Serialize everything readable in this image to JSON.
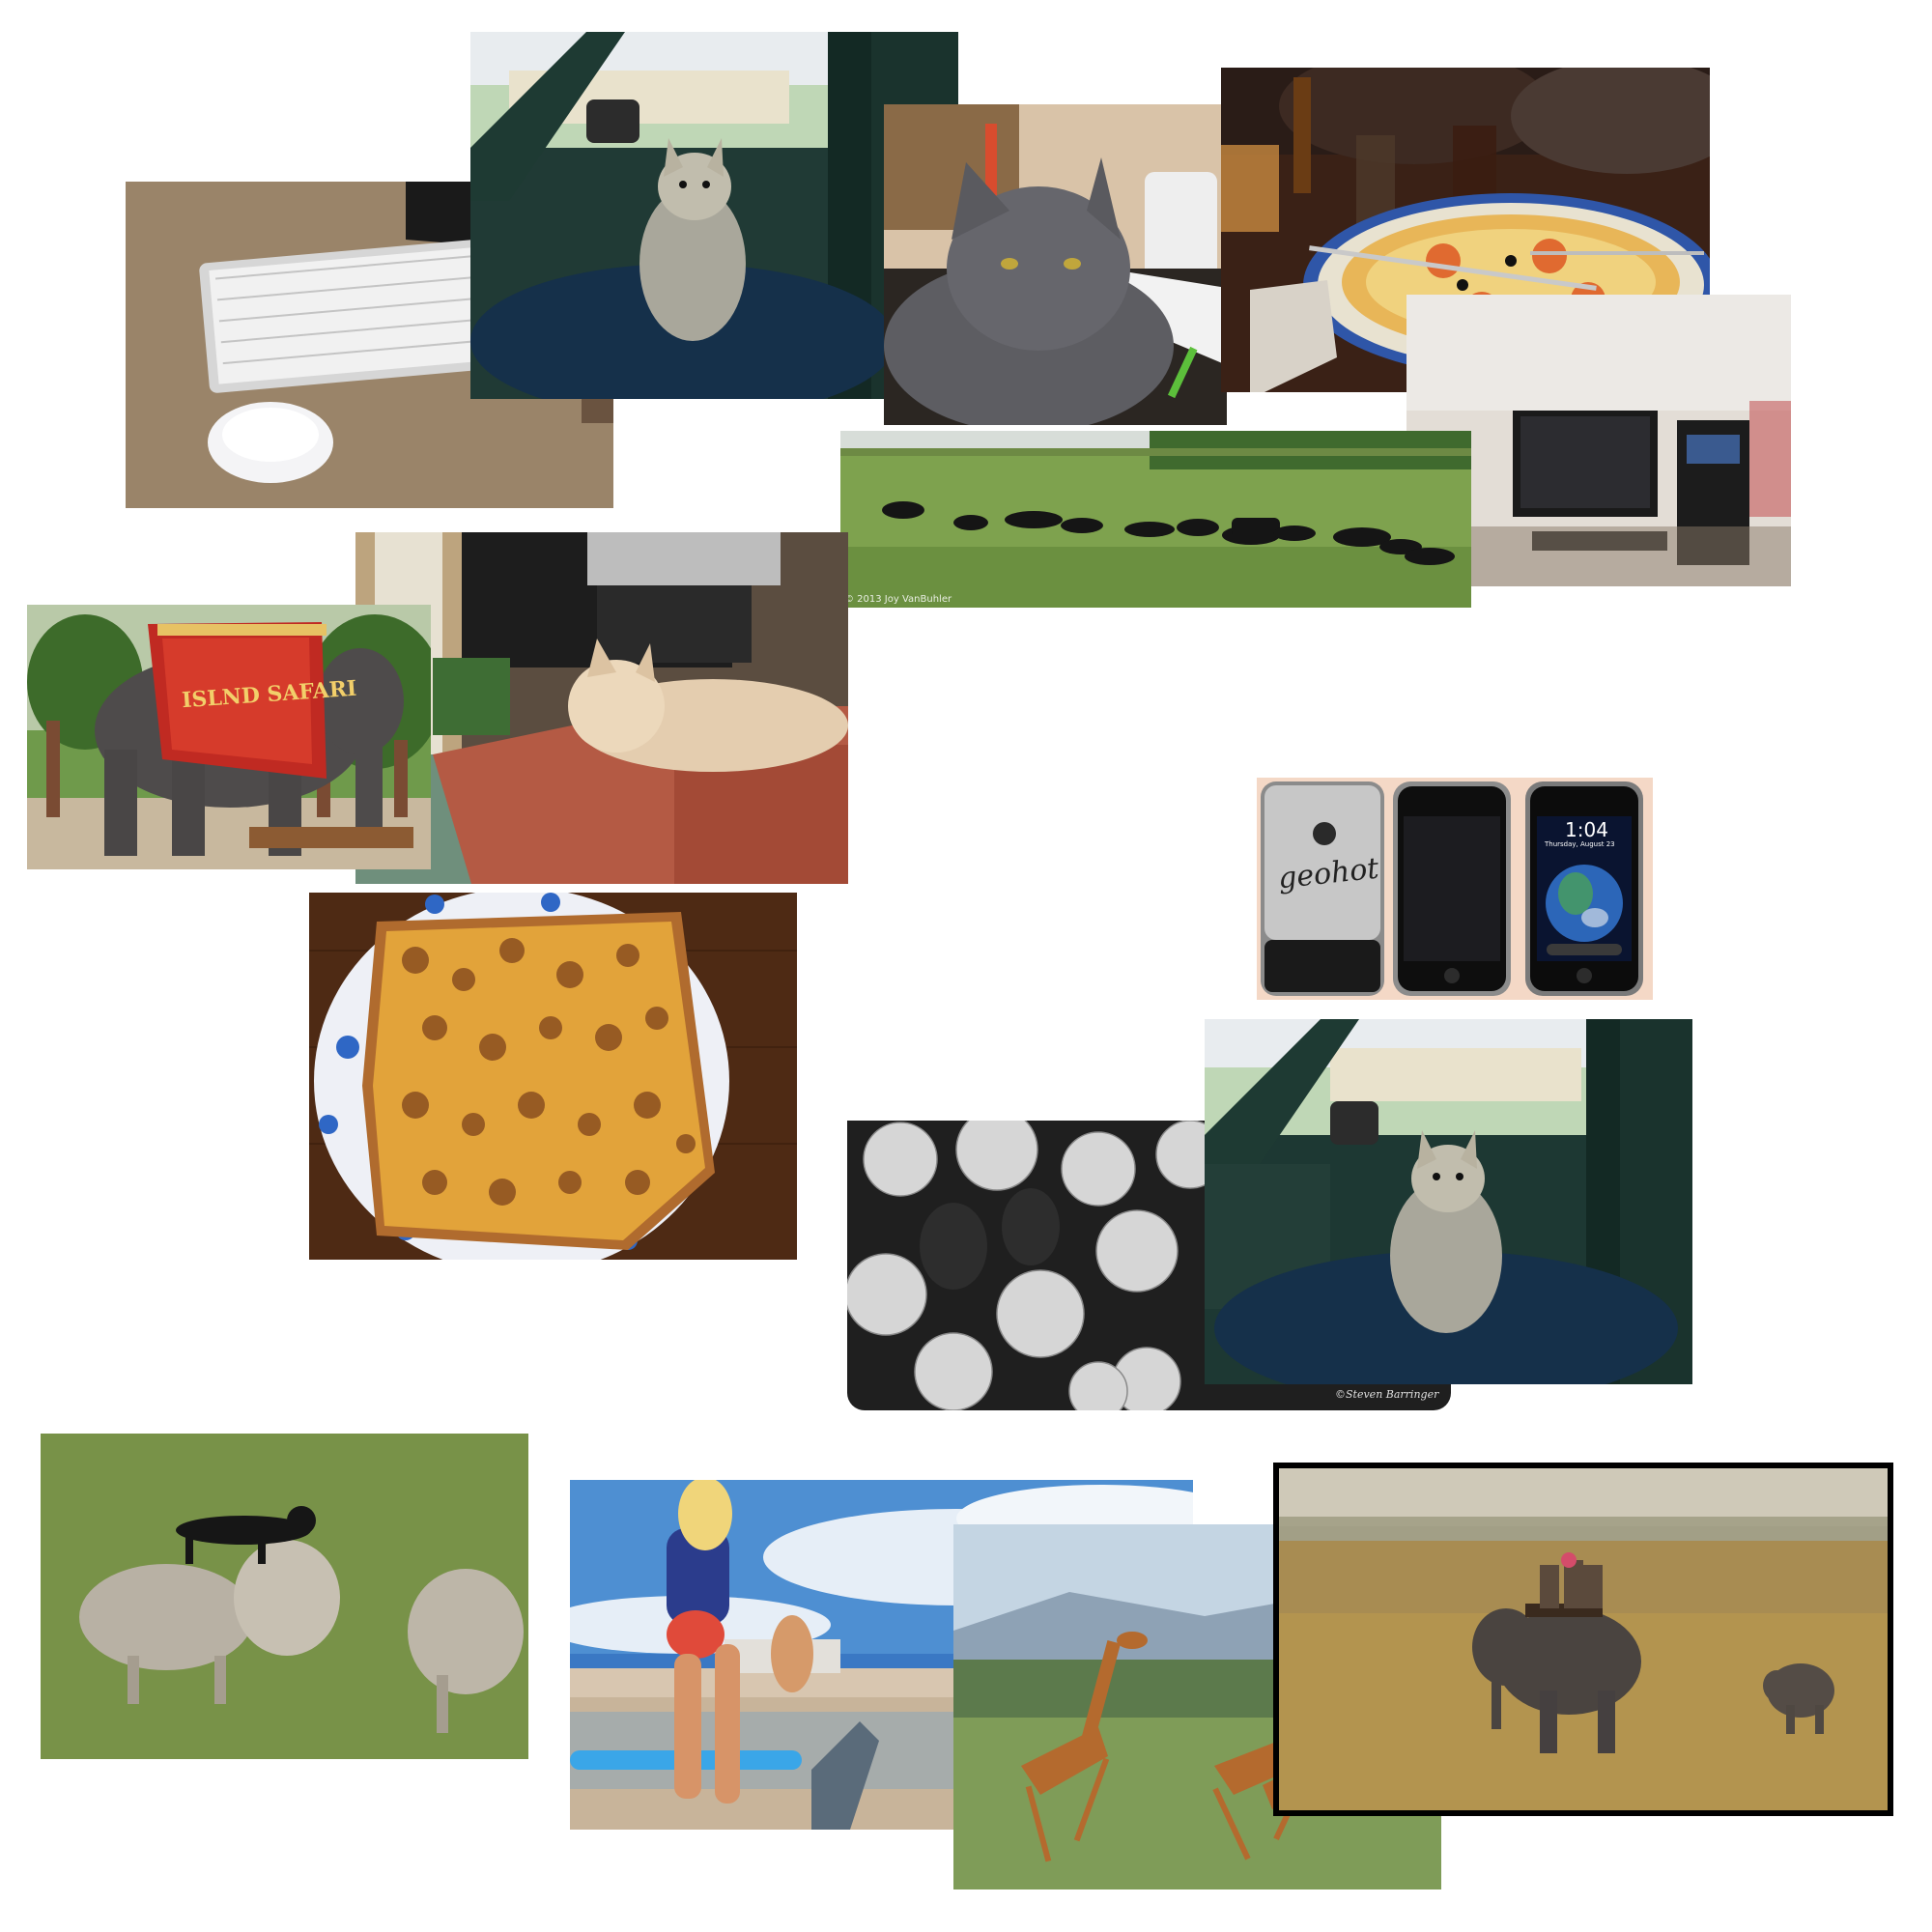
{
  "canvas": {
    "background": "#ffffff"
  },
  "photos": [
    {
      "name": "keyboard-mouse-photo",
      "subject": "keyboard-and-mouse"
    },
    {
      "name": "dog-in-truck-photo-top",
      "subject": "chihuahua-in-truck"
    },
    {
      "name": "gray-cat-photo",
      "subject": "gray-cat"
    },
    {
      "name": "pizza-table-photo",
      "subject": "pizza-and-drinks"
    },
    {
      "name": "computer-desk-photo",
      "subject": "desktop-computer"
    },
    {
      "name": "cattle-field-photo",
      "subject": "cattle-in-field"
    },
    {
      "name": "cat-on-cushion-photo",
      "subject": "cat-on-cushion"
    },
    {
      "name": "safari-elephant-photo",
      "subject": "elephant-with-blanket"
    },
    {
      "name": "iphone-photo",
      "subject": "three-iphones"
    },
    {
      "name": "walnut-cake-photo",
      "subject": "walnut-cake"
    },
    {
      "name": "dog-in-truck-photo-bottom",
      "subject": "chihuahua-in-truck"
    },
    {
      "name": "umbrellas-photo",
      "subject": "paper-umbrellas"
    },
    {
      "name": "sheep-dog-photo",
      "subject": "dog-and-sheep"
    },
    {
      "name": "beach-surfer-photo",
      "subject": "girl-with-surfboard"
    },
    {
      "name": "giraffes-photo",
      "subject": "running-giraffes"
    },
    {
      "name": "elephant-ride-photo",
      "subject": "people-riding-elephant"
    }
  ],
  "text": {
    "cattle_watermark": "© 2013 Joy VanBuhler",
    "blanket_text": "ISLND SAFARI",
    "phone_engraving": "geohot",
    "phone_clock": "1:04",
    "phone_date": "Thursday, August 23",
    "umbrella_watermark": "©Steven Barringer"
  }
}
